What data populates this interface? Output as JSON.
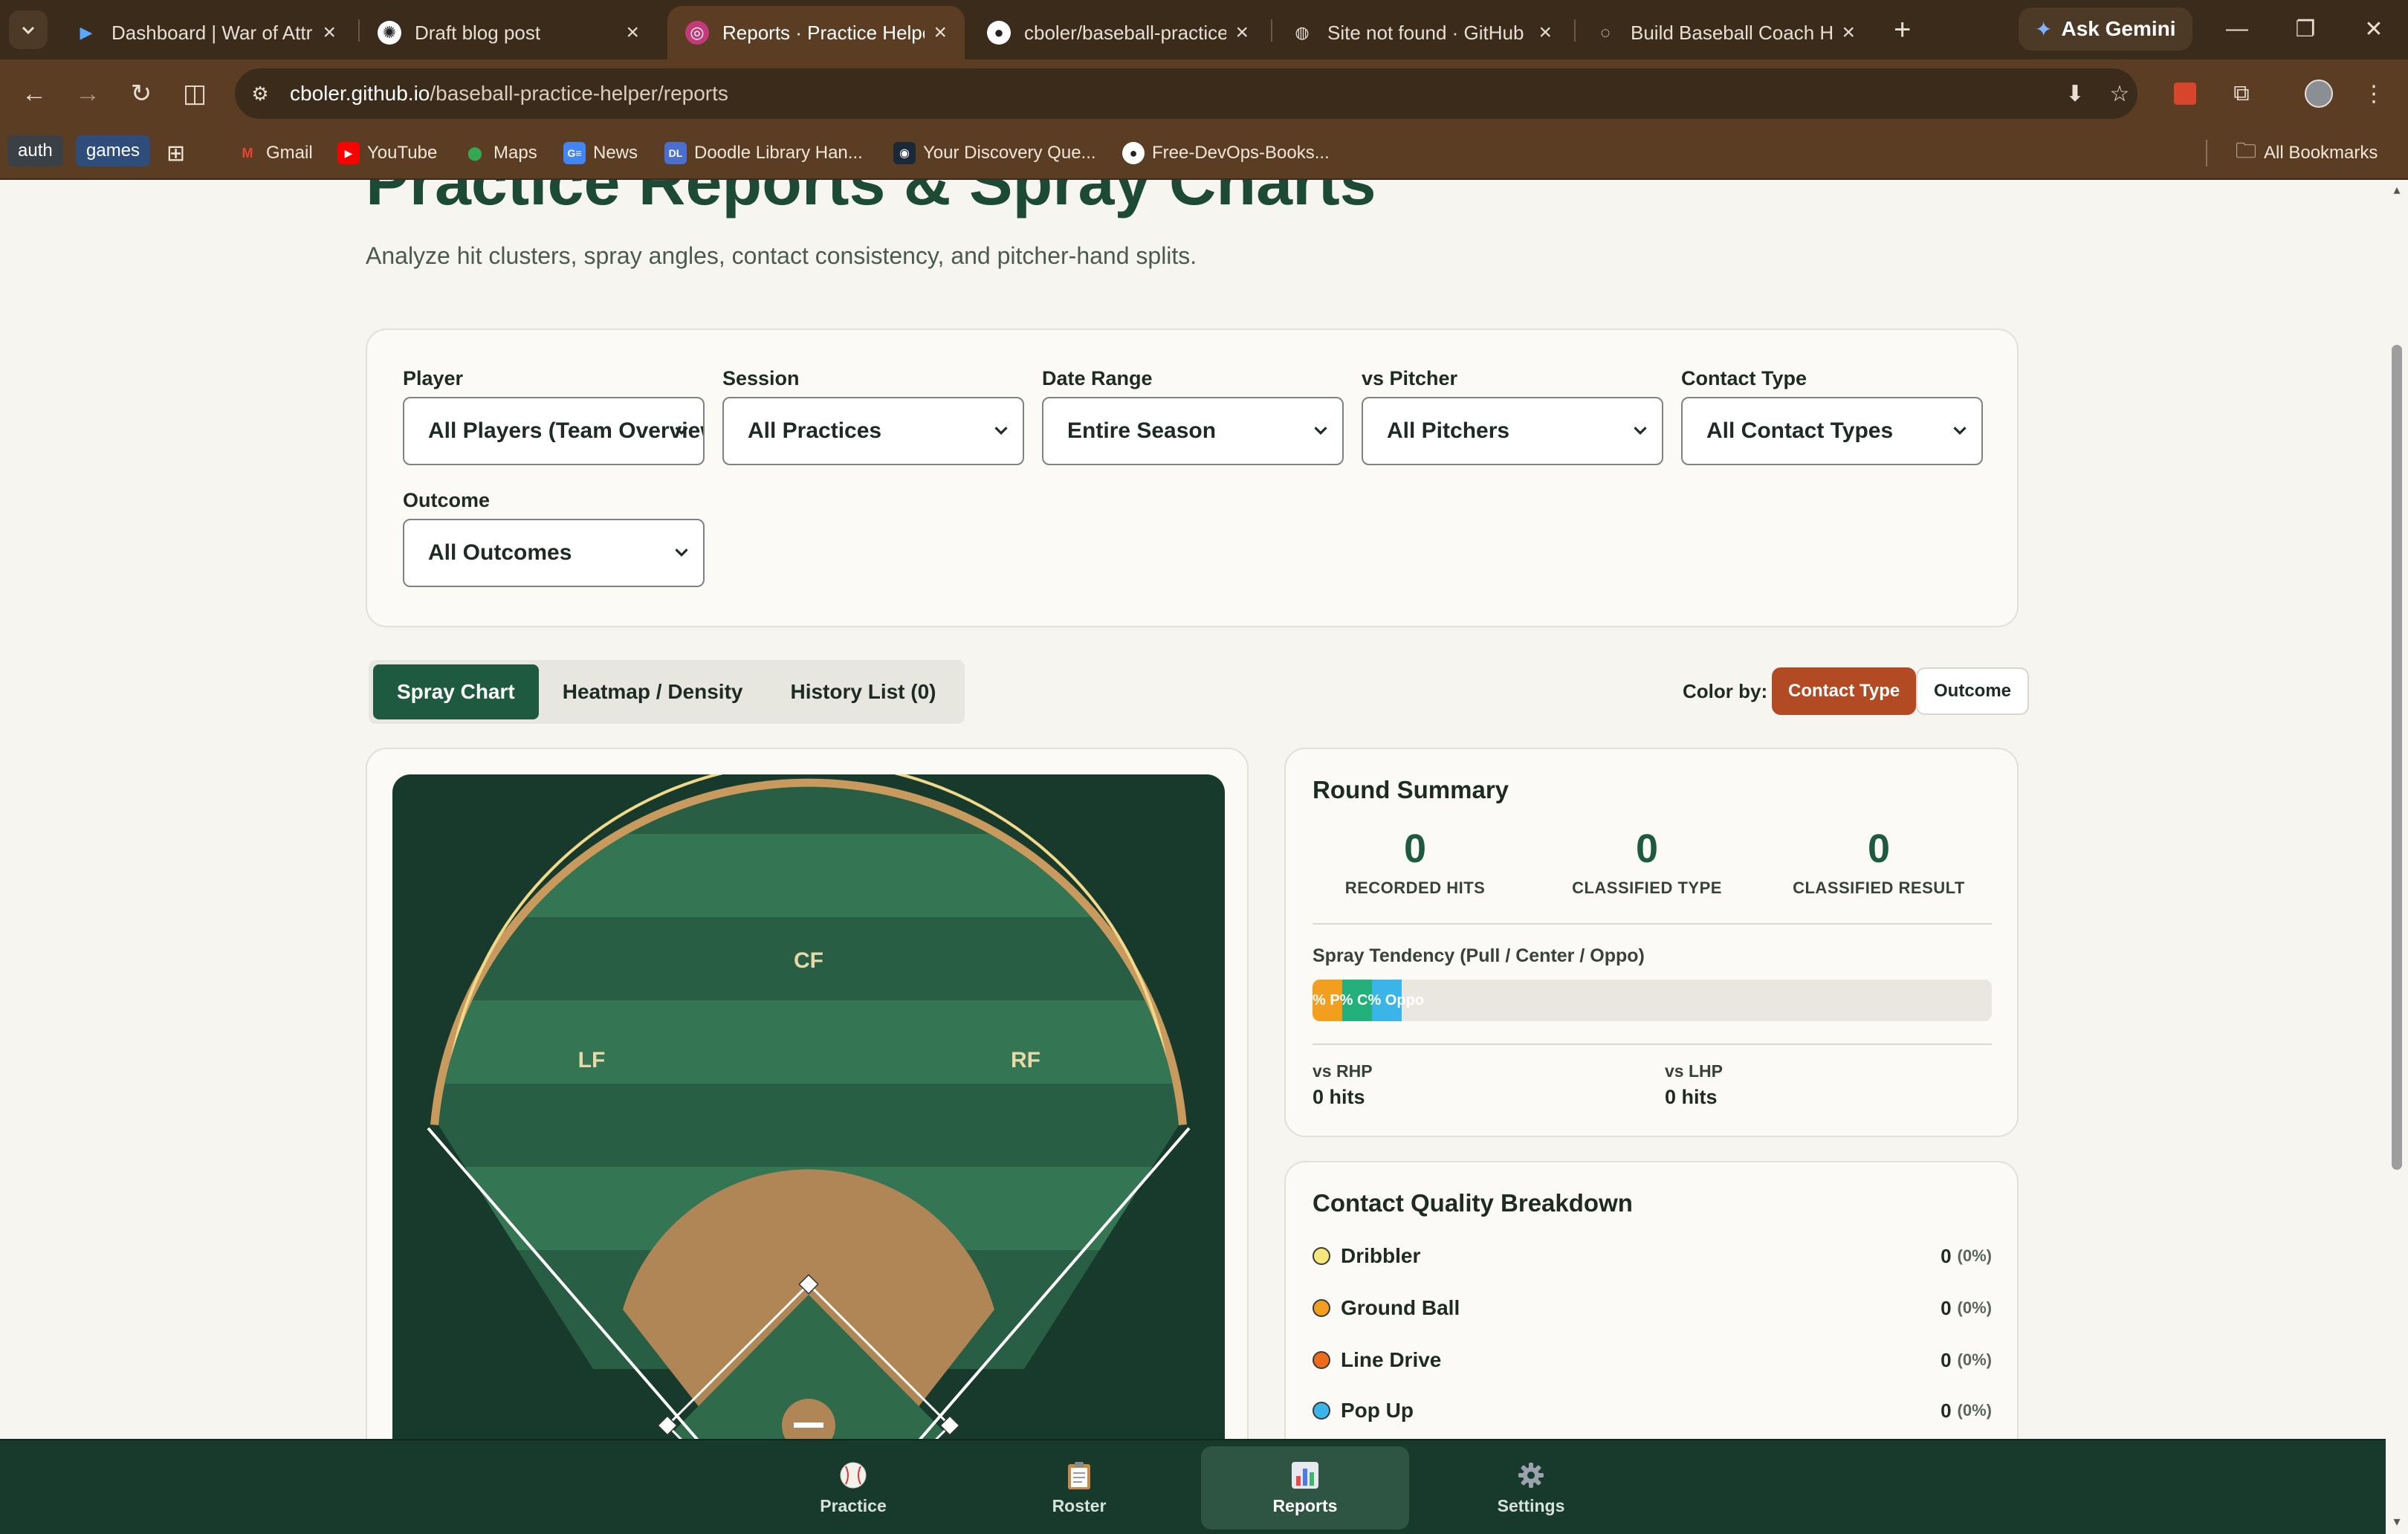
{
  "browser": {
    "tabs": [
      {
        "title": "Dashboard | War of Attrit",
        "favicon": "vercel-icon",
        "active": false
      },
      {
        "title": "Draft blog post",
        "favicon": "openai-icon",
        "active": false
      },
      {
        "title": "Reports · Practice Helper",
        "favicon": "baseball-icon",
        "active": true
      },
      {
        "title": "cboler/baseball-practice-",
        "favicon": "github-icon",
        "active": false
      },
      {
        "title": "Site not found · GitHub P",
        "favicon": "globe-icon",
        "active": false
      },
      {
        "title": "Build Baseball Coach Hel",
        "favicon": "loading-icon",
        "active": false
      }
    ],
    "ask_gemini": "Ask Gemini",
    "url_host": "cboler.github.io",
    "url_path": "/baseball-practice-helper/reports",
    "bookmarks": [
      {
        "label": "auth",
        "type": "chip"
      },
      {
        "label": "games",
        "type": "chip"
      },
      {
        "label": "Gmail",
        "icon": "gmail-icon"
      },
      {
        "label": "YouTube",
        "icon": "youtube-icon"
      },
      {
        "label": "Maps",
        "icon": "maps-icon"
      },
      {
        "label": "News",
        "icon": "news-icon"
      },
      {
        "label": "Doodle Library Han...",
        "icon": "doodle-icon"
      },
      {
        "label": "Your Discovery Que...",
        "icon": "steam-icon"
      },
      {
        "label": "Free-DevOps-Books...",
        "icon": "github-icon"
      }
    ],
    "all_bookmarks": "All Bookmarks"
  },
  "page": {
    "title": "Practice Reports & Spray Charts",
    "subtitle": "Analyze hit clusters, spray angles, contact consistency, and pitcher-hand splits."
  },
  "filters": [
    {
      "label": "Player",
      "value": "All Players (Team Overview)"
    },
    {
      "label": "Session",
      "value": "All Practices"
    },
    {
      "label": "Date Range",
      "value": "Entire Season"
    },
    {
      "label": "vs Pitcher",
      "value": "All Pitchers"
    },
    {
      "label": "Contact Type",
      "value": "All Contact Types"
    },
    {
      "label": "Outcome",
      "value": "All Outcomes"
    }
  ],
  "view_tabs": [
    {
      "label": "Spray Chart",
      "active": true
    },
    {
      "label": "Heatmap / Density",
      "active": false
    },
    {
      "label": "History List (0)",
      "active": false
    }
  ],
  "color_by": {
    "label": "Color by:",
    "options": [
      {
        "label": "Contact Type",
        "active": true
      },
      {
        "label": "Outcome",
        "active": false
      }
    ]
  },
  "field": {
    "labels": {
      "cf": "CF",
      "lf": "LF",
      "rf": "RF"
    },
    "colors": {
      "bg": "#173a2d",
      "grass_dark": "#285e43",
      "grass_light": "#347553",
      "dirt": "#b08656",
      "warning": "#c99a5e"
    }
  },
  "round_summary": {
    "title": "Round Summary",
    "stats": [
      {
        "value": "0",
        "label": "RECORDED HITS"
      },
      {
        "value": "0",
        "label": "CLASSIFIED TYPE"
      },
      {
        "value": "0",
        "label": "CLASSIFIED RESULT"
      }
    ],
    "tendency_label": "Spray Tendency (Pull / Center / Oppo)",
    "tendency_text": "% P% C% Oppo",
    "tendency": [
      {
        "name": "Pull",
        "share": 0,
        "color": "#f29e1f"
      },
      {
        "name": "Center",
        "share": 0,
        "color": "#24b07c"
      },
      {
        "name": "Oppo",
        "share": 0,
        "color": "#3bb5e8"
      }
    ],
    "splits": [
      {
        "label": "vs RHP",
        "value": "0 hits"
      },
      {
        "label": "vs LHP",
        "value": "0 hits"
      }
    ]
  },
  "contact_quality": {
    "title": "Contact Quality Breakdown",
    "rows": [
      {
        "name": "Dribbler",
        "count": "0",
        "pct": "(0%)",
        "color": "#f5e77a"
      },
      {
        "name": "Ground Ball",
        "count": "0",
        "pct": "(0%)",
        "color": "#f29e1f"
      },
      {
        "name": "Line Drive",
        "count": "0",
        "pct": "(0%)",
        "color": "#ee6b1c"
      },
      {
        "name": "Pop Up",
        "count": "0",
        "pct": "(0%)",
        "color": "#3bb5e8"
      }
    ]
  },
  "bottom_nav": [
    {
      "label": "Practice",
      "icon": "baseball-icon",
      "active": false
    },
    {
      "label": "Roster",
      "icon": "clipboard-icon",
      "active": false
    },
    {
      "label": "Reports",
      "icon": "bar-chart-icon",
      "active": true
    },
    {
      "label": "Settings",
      "icon": "gear-icon",
      "active": false
    }
  ]
}
